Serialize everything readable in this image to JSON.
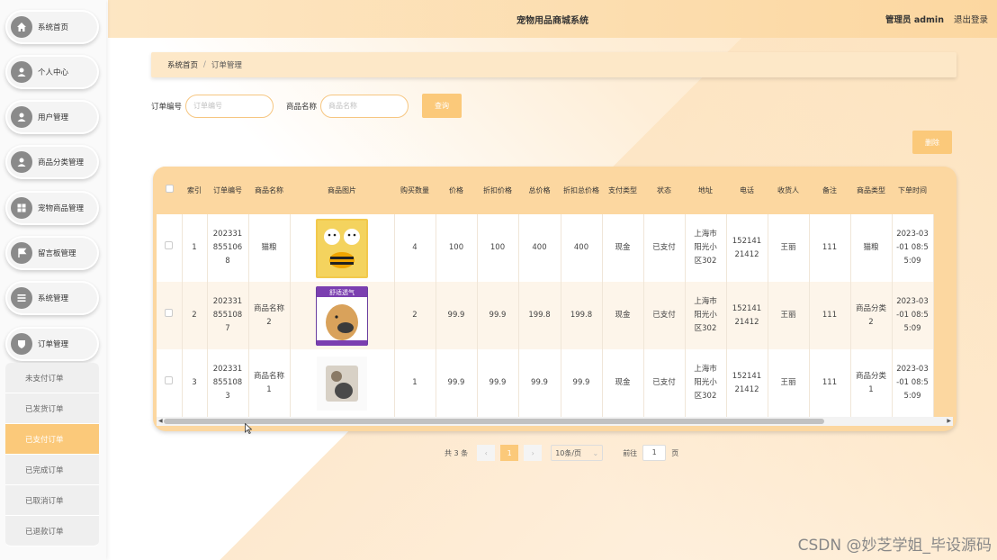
{
  "header": {
    "title": "宠物用品商城系统",
    "user": "管理员 admin",
    "logout": "退出登录"
  },
  "sidebar": {
    "items": [
      {
        "label": "系统首页",
        "icon": "home-icon"
      },
      {
        "label": "个人中心",
        "icon": "user-icon"
      },
      {
        "label": "用户管理",
        "icon": "user-icon"
      },
      {
        "label": "商品分类管理",
        "icon": "user-icon"
      },
      {
        "label": "宠物商品管理",
        "icon": "grid-icon"
      },
      {
        "label": "留言板管理",
        "icon": "flag-icon"
      },
      {
        "label": "系统管理",
        "icon": "menu-icon"
      },
      {
        "label": "订单管理",
        "icon": "shield-icon"
      }
    ],
    "submenu": [
      {
        "label": "未支付订单",
        "active": false
      },
      {
        "label": "已发货订单",
        "active": false
      },
      {
        "label": "已支付订单",
        "active": true
      },
      {
        "label": "已完成订单",
        "active": false
      },
      {
        "label": "已取消订单",
        "active": false
      },
      {
        "label": "已退款订单",
        "active": false
      }
    ]
  },
  "breadcrumb": {
    "home": "系统首页",
    "sep": "/",
    "current": "订单管理"
  },
  "search": {
    "order_label": "订单编号",
    "order_placeholder": "订单编号",
    "name_label": "商品名称",
    "name_placeholder": "商品名称",
    "query_button": "查询"
  },
  "delete_button": "删除",
  "table": {
    "headers": [
      "索引",
      "订单编号",
      "商品名称",
      "商品图片",
      "购买数量",
      "价格",
      "折扣价格",
      "总价格",
      "折扣总价格",
      "支付类型",
      "状态",
      "地址",
      "电话",
      "收货人",
      "备注",
      "商品类型",
      "下单时间"
    ],
    "rows": [
      {
        "index": "1",
        "order_no": "2023318551068",
        "name": "猫粮",
        "image": "dog-in-bee-costume",
        "qty": "4",
        "price": "100",
        "discount_price": "100",
        "total": "400",
        "discount_total": "400",
        "pay": "现金",
        "status": "已支付",
        "address": "上海市阳光小区302",
        "phone": "15214121412",
        "receiver": "王丽",
        "note": "111",
        "type": "猫粮",
        "time": "2023-03-01 08:55:09"
      },
      {
        "index": "2",
        "order_no": "2023318551087",
        "name": "商品名称2",
        "image": "dog-muzzle-ad",
        "qty": "2",
        "price": "99.9",
        "discount_price": "99.9",
        "total": "199.8",
        "discount_total": "199.8",
        "pay": "现金",
        "status": "已支付",
        "address": "上海市阳光小区302",
        "phone": "15214121412",
        "receiver": "王丽",
        "note": "111",
        "type": "商品分类2",
        "time": "2023-03-01 08:55:09"
      },
      {
        "index": "3",
        "order_no": "2023318551083",
        "name": "商品名称1",
        "image": "pet-product-photo",
        "qty": "1",
        "price": "99.9",
        "discount_price": "99.9",
        "total": "99.9",
        "discount_total": "99.9",
        "pay": "现金",
        "status": "已支付",
        "address": "上海市阳光小区302",
        "phone": "15214121412",
        "receiver": "王丽",
        "note": "111",
        "type": "商品分类1",
        "time": "2023-03-01 08:55:09"
      }
    ],
    "image_banner_text": "舒适透气"
  },
  "pagination": {
    "total": "共 3 条",
    "current_page": "1",
    "page_size": "10条/页",
    "goto_label": "前往",
    "goto_value": "1",
    "page_suffix": "页"
  },
  "watermark": "CSDN @妙芝学姐_毕设源码",
  "colors": {
    "accent": "#fbc97a",
    "header": "#fcd7a0"
  }
}
